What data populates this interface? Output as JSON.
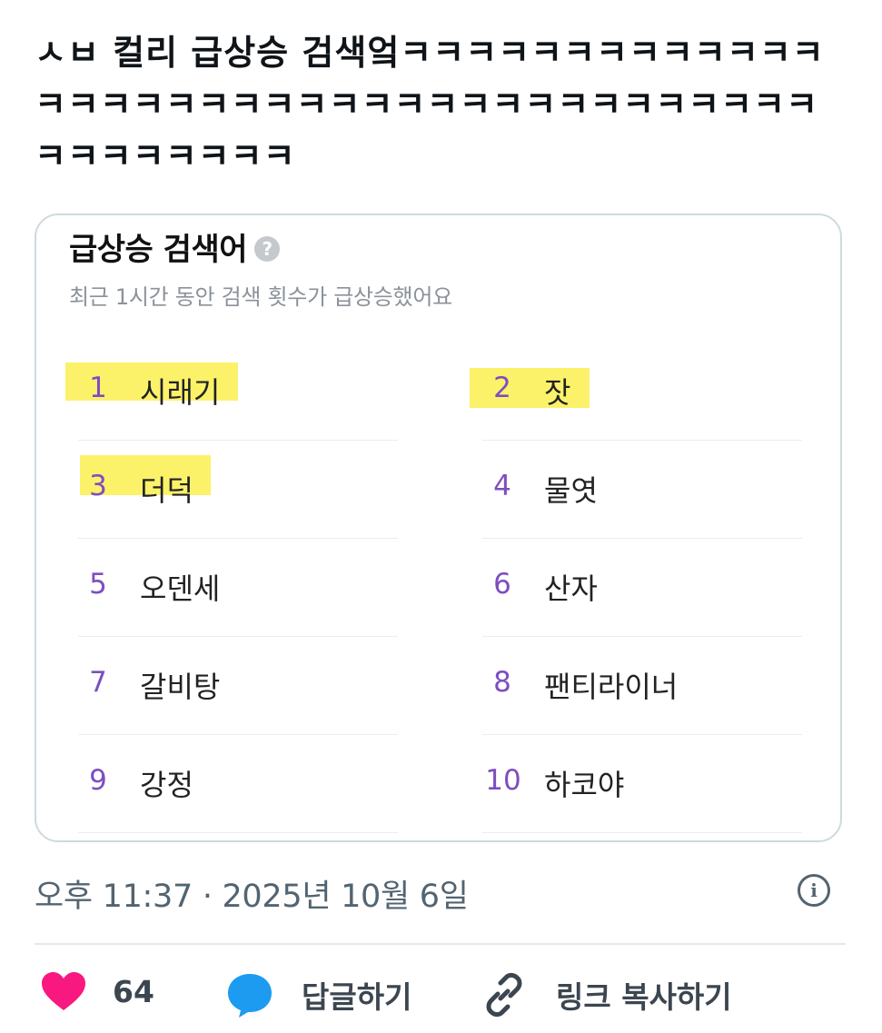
{
  "tweet": {
    "text": "ㅅㅂ 컬리 급상승 검색엌ㅋㅋㅋㅋㅋㅋㅋㅋㅋㅋㅋㅋㅋㅋㅋㅋㅋㅋㅋㅋㅋㅋㅋㅋㅋㅋㅋㅋㅋㅋㅋㅋㅋㅋㅋㅋㅋㅋㅋㅋㅋㅋㅋㅋㅋ",
    "timestamp": "오후 11:37 · 2025년 10월 6일"
  },
  "card": {
    "title": "급상승 검색어",
    "help_icon": "?",
    "subtitle": "최근 1시간 동안 검색 횟수가 급상승했어요",
    "items": [
      {
        "rank": "1",
        "label": "시래기",
        "highlighted": true
      },
      {
        "rank": "2",
        "label": "잣",
        "highlighted": true
      },
      {
        "rank": "3",
        "label": "더덕",
        "highlighted": true
      },
      {
        "rank": "4",
        "label": "물엿",
        "highlighted": false
      },
      {
        "rank": "5",
        "label": "오덴세",
        "highlighted": false
      },
      {
        "rank": "6",
        "label": "산자",
        "highlighted": false
      },
      {
        "rank": "7",
        "label": "갈비탕",
        "highlighted": false
      },
      {
        "rank": "8",
        "label": "팬티라이너",
        "highlighted": false
      },
      {
        "rank": "9",
        "label": "강정",
        "highlighted": false
      },
      {
        "rank": "10",
        "label": "하코야",
        "highlighted": false
      }
    ]
  },
  "actions": {
    "like_count": "64",
    "reply_label": "답글하기",
    "copy_link_label": "링크 복사하기"
  },
  "colors": {
    "rank_number": "#7d4ec0",
    "highlight": "#fbf26a",
    "like": "#f91880",
    "reply": "#1d9bf0",
    "meta_text": "#536471"
  },
  "icons": {
    "info": "info-icon",
    "like": "heart-icon",
    "reply": "speech-bubble-icon",
    "link": "link-icon"
  }
}
